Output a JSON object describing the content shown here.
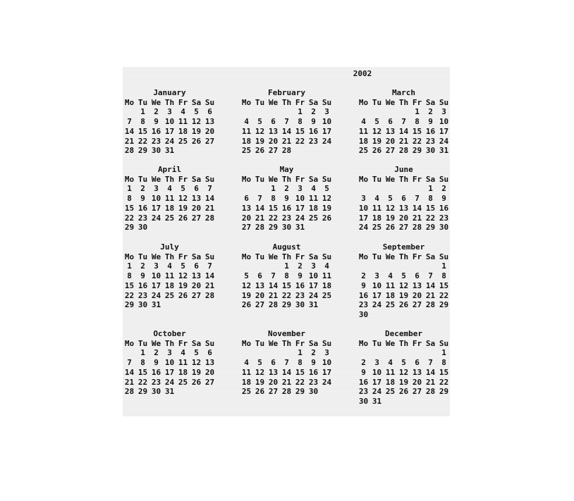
{
  "year": "2002",
  "weekdays": [
    "Mo",
    "Tu",
    "We",
    "Th",
    "Fr",
    "Sa",
    "Su"
  ],
  "months": [
    {
      "name": "January",
      "weeks": [
        [
          "",
          "1",
          "2",
          "3",
          "4",
          "5",
          "6"
        ],
        [
          "7",
          "8",
          "9",
          "10",
          "11",
          "12",
          "13"
        ],
        [
          "14",
          "15",
          "16",
          "17",
          "18",
          "19",
          "20"
        ],
        [
          "21",
          "22",
          "23",
          "24",
          "25",
          "26",
          "27"
        ],
        [
          "28",
          "29",
          "30",
          "31",
          "",
          "",
          ""
        ]
      ]
    },
    {
      "name": "February",
      "weeks": [
        [
          "",
          "",
          "",
          "",
          "1",
          "2",
          "3"
        ],
        [
          "4",
          "5",
          "6",
          "7",
          "8",
          "9",
          "10"
        ],
        [
          "11",
          "12",
          "13",
          "14",
          "15",
          "16",
          "17"
        ],
        [
          "18",
          "19",
          "20",
          "21",
          "22",
          "23",
          "24"
        ],
        [
          "25",
          "26",
          "27",
          "28",
          "",
          "",
          ""
        ]
      ]
    },
    {
      "name": "March",
      "weeks": [
        [
          "",
          "",
          "",
          "",
          "1",
          "2",
          "3"
        ],
        [
          "4",
          "5",
          "6",
          "7",
          "8",
          "9",
          "10"
        ],
        [
          "11",
          "12",
          "13",
          "14",
          "15",
          "16",
          "17"
        ],
        [
          "18",
          "19",
          "20",
          "21",
          "22",
          "23",
          "24"
        ],
        [
          "25",
          "26",
          "27",
          "28",
          "29",
          "30",
          "31"
        ]
      ]
    },
    {
      "name": "April",
      "weeks": [
        [
          "1",
          "2",
          "3",
          "4",
          "5",
          "6",
          "7"
        ],
        [
          "8",
          "9",
          "10",
          "11",
          "12",
          "13",
          "14"
        ],
        [
          "15",
          "16",
          "17",
          "18",
          "19",
          "20",
          "21"
        ],
        [
          "22",
          "23",
          "24",
          "25",
          "26",
          "27",
          "28"
        ],
        [
          "29",
          "30",
          "",
          "",
          "",
          "",
          ""
        ]
      ]
    },
    {
      "name": "May",
      "weeks": [
        [
          "",
          "",
          "1",
          "2",
          "3",
          "4",
          "5"
        ],
        [
          "6",
          "7",
          "8",
          "9",
          "10",
          "11",
          "12"
        ],
        [
          "13",
          "14",
          "15",
          "16",
          "17",
          "18",
          "19"
        ],
        [
          "20",
          "21",
          "22",
          "23",
          "24",
          "25",
          "26"
        ],
        [
          "27",
          "28",
          "29",
          "30",
          "31",
          "",
          ""
        ]
      ]
    },
    {
      "name": "June",
      "weeks": [
        [
          "",
          "",
          "",
          "",
          "",
          "1",
          "2"
        ],
        [
          "3",
          "4",
          "5",
          "6",
          "7",
          "8",
          "9"
        ],
        [
          "10",
          "11",
          "12",
          "13",
          "14",
          "15",
          "16"
        ],
        [
          "17",
          "18",
          "19",
          "20",
          "21",
          "22",
          "23"
        ],
        [
          "24",
          "25",
          "26",
          "27",
          "28",
          "29",
          "30"
        ]
      ]
    },
    {
      "name": "July",
      "weeks": [
        [
          "1",
          "2",
          "3",
          "4",
          "5",
          "6",
          "7"
        ],
        [
          "8",
          "9",
          "10",
          "11",
          "12",
          "13",
          "14"
        ],
        [
          "15",
          "16",
          "17",
          "18",
          "19",
          "20",
          "21"
        ],
        [
          "22",
          "23",
          "24",
          "25",
          "26",
          "27",
          "28"
        ],
        [
          "29",
          "30",
          "31",
          "",
          "",
          "",
          ""
        ]
      ]
    },
    {
      "name": "August",
      "weeks": [
        [
          "",
          "",
          "",
          "1",
          "2",
          "3",
          "4"
        ],
        [
          "5",
          "6",
          "7",
          "8",
          "9",
          "10",
          "11"
        ],
        [
          "12",
          "13",
          "14",
          "15",
          "16",
          "17",
          "18"
        ],
        [
          "19",
          "20",
          "21",
          "22",
          "23",
          "24",
          "25"
        ],
        [
          "26",
          "27",
          "28",
          "29",
          "30",
          "31",
          ""
        ]
      ]
    },
    {
      "name": "September",
      "weeks": [
        [
          "",
          "",
          "",
          "",
          "",
          "",
          "1"
        ],
        [
          "2",
          "3",
          "4",
          "5",
          "6",
          "7",
          "8"
        ],
        [
          "9",
          "10",
          "11",
          "12",
          "13",
          "14",
          "15"
        ],
        [
          "16",
          "17",
          "18",
          "19",
          "20",
          "21",
          "22"
        ],
        [
          "23",
          "24",
          "25",
          "26",
          "27",
          "28",
          "29"
        ],
        [
          "30",
          "",
          "",
          "",
          "",
          "",
          ""
        ]
      ]
    },
    {
      "name": "October",
      "weeks": [
        [
          "",
          "1",
          "2",
          "3",
          "4",
          "5",
          "6"
        ],
        [
          "7",
          "8",
          "9",
          "10",
          "11",
          "12",
          "13"
        ],
        [
          "14",
          "15",
          "16",
          "17",
          "18",
          "19",
          "20"
        ],
        [
          "21",
          "22",
          "23",
          "24",
          "25",
          "26",
          "27"
        ],
        [
          "28",
          "29",
          "30",
          "31",
          "",
          "",
          ""
        ]
      ]
    },
    {
      "name": "November",
      "weeks": [
        [
          "",
          "",
          "",
          "",
          "1",
          "2",
          "3"
        ],
        [
          "4",
          "5",
          "6",
          "7",
          "8",
          "9",
          "10"
        ],
        [
          "11",
          "12",
          "13",
          "14",
          "15",
          "16",
          "17"
        ],
        [
          "18",
          "19",
          "20",
          "21",
          "22",
          "23",
          "24"
        ],
        [
          "25",
          "26",
          "27",
          "28",
          "29",
          "30",
          ""
        ]
      ]
    },
    {
      "name": "December",
      "weeks": [
        [
          "",
          "",
          "",
          "",
          "",
          "",
          "1"
        ],
        [
          "2",
          "3",
          "4",
          "5",
          "6",
          "7",
          "8"
        ],
        [
          "9",
          "10",
          "11",
          "12",
          "13",
          "14",
          "15"
        ],
        [
          "16",
          "17",
          "18",
          "19",
          "20",
          "21",
          "22"
        ],
        [
          "23",
          "24",
          "25",
          "26",
          "27",
          "28",
          "29"
        ],
        [
          "30",
          "31",
          "",
          "",
          "",
          "",
          ""
        ]
      ]
    }
  ]
}
